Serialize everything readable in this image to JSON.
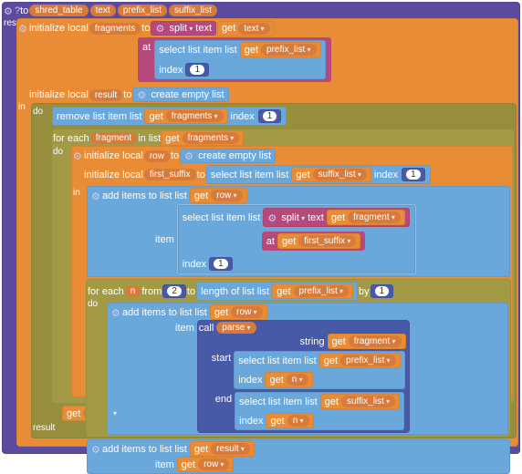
{
  "procdef": {
    "to_kw": "to",
    "name": "shred_table",
    "params": [
      "text",
      "prefix_list",
      "suffix_list"
    ],
    "result_kw": "result"
  },
  "kw": {
    "init_local": "initialize local",
    "to": "to",
    "in": "in",
    "do": "do",
    "for_each": "for each",
    "in_list": "in list",
    "from": "from",
    "by": "by",
    "item": "item",
    "index": "index",
    "at": "at",
    "list_kw": "list",
    "text_kw": "text",
    "string_kw": "string",
    "start_kw": "start",
    "end_kw": "end",
    "result": "result",
    "call": "call"
  },
  "vars": {
    "fragments": "fragments",
    "result": "result",
    "fragment": "fragment",
    "row": "row",
    "first_suffix": "first_suffix",
    "n": "n",
    "text": "text",
    "prefix_list": "prefix_list",
    "suffix_list": "suffix_list"
  },
  "ops": {
    "split": "split",
    "create_empty_list": "create empty list",
    "remove_list_item": "remove list item",
    "select_list_item": "select list item",
    "add_items_to_list": "add items to list",
    "length_of_list": "length of list",
    "get": "get",
    "parse": "parse"
  },
  "nums": {
    "one": "1",
    "two": "2"
  }
}
